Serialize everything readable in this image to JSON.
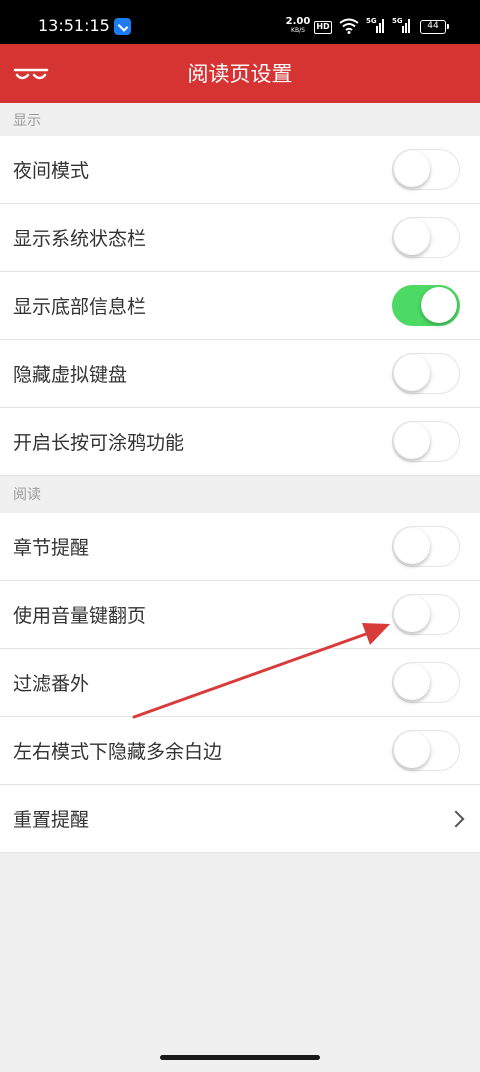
{
  "status_bar": {
    "time": "13:51:15",
    "speed_value": "2.00",
    "speed_unit": "KB/S",
    "hd_label": "HD",
    "signal_label": "5G",
    "battery": "44",
    "app_icon": "navigation-app-icon"
  },
  "header": {
    "title": "阅读页设置",
    "back_icon": "mustache-back-icon"
  },
  "sections": {
    "display": {
      "title": "显示"
    },
    "reading": {
      "title": "阅读"
    }
  },
  "settings": {
    "night_mode": {
      "label": "夜间模式",
      "enabled": false
    },
    "status_bar": {
      "label": "显示系统状态栏",
      "enabled": false
    },
    "bottom_info": {
      "label": "显示底部信息栏",
      "enabled": true
    },
    "hide_keyboard": {
      "label": "隐藏虚拟键盘",
      "enabled": false
    },
    "long_press_doodle": {
      "label": "开启长按可涂鸦功能",
      "enabled": false
    },
    "chapter_reminder": {
      "label": "章节提醒",
      "enabled": false
    },
    "volume_page_turn": {
      "label": "使用音量键翻页",
      "enabled": false
    },
    "filter_extras": {
      "label": "过滤番外",
      "enabled": false
    },
    "hide_margins": {
      "label": "左右模式下隐藏多余白边",
      "enabled": false
    },
    "reset_reminder": {
      "label": "重置提醒"
    }
  },
  "colors": {
    "header_red": "#d63333",
    "toggle_on": "#4cd964",
    "arrow_red": "#d93a3a"
  }
}
